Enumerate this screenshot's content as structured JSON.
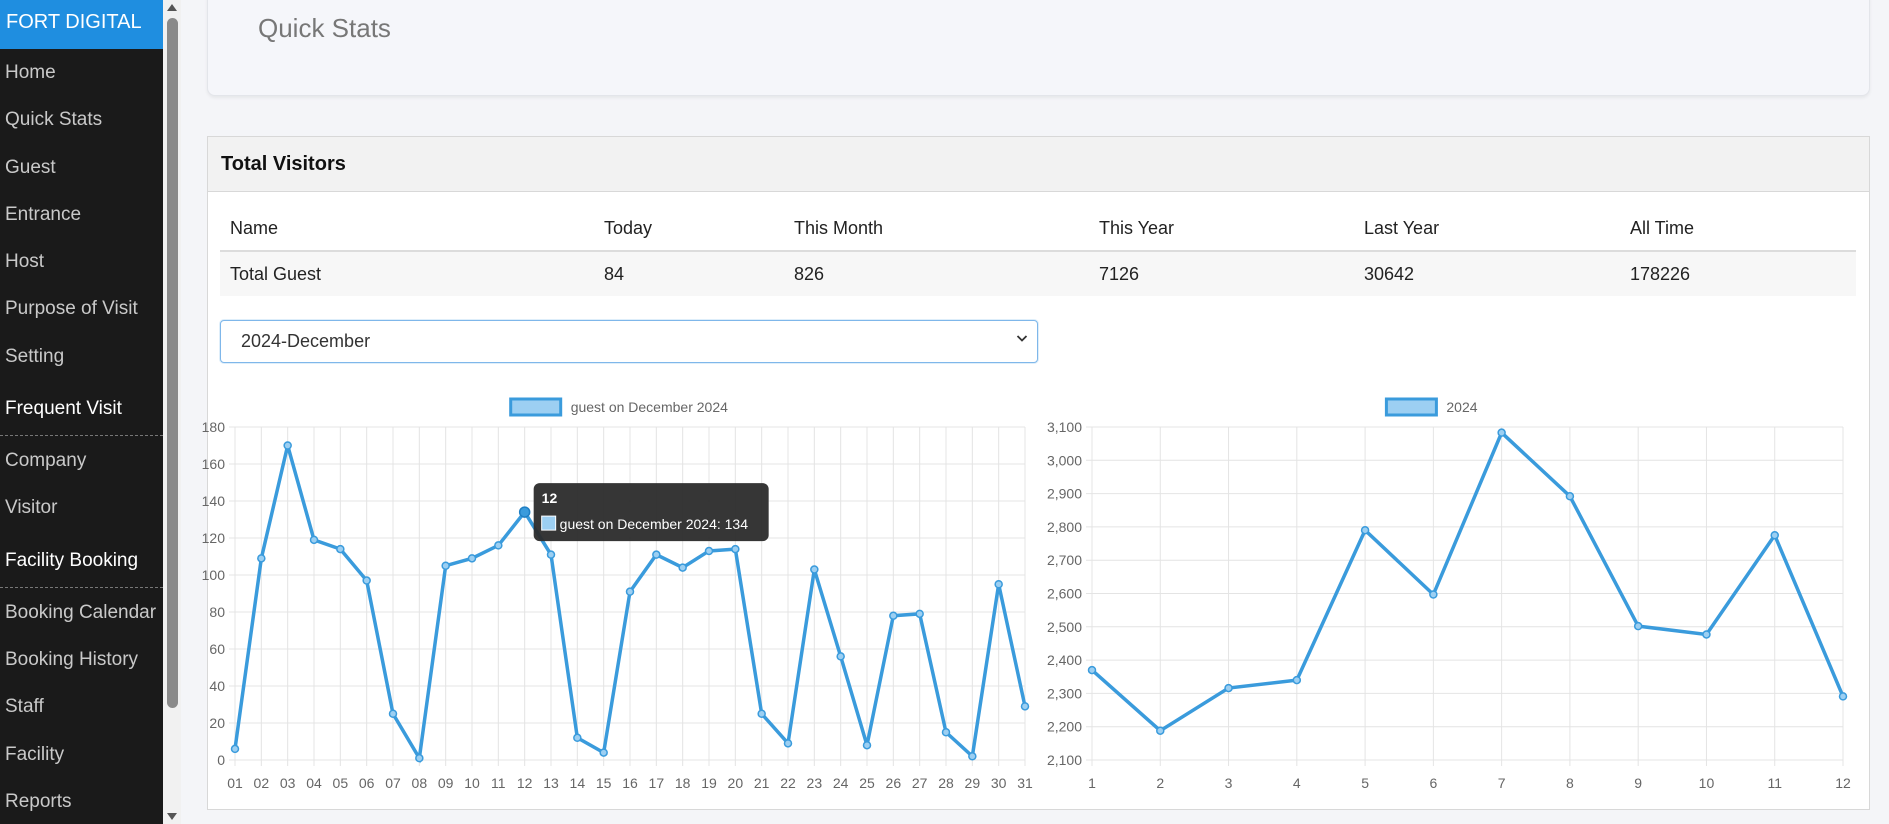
{
  "sidebar": {
    "brand": "FORT DIGITAL",
    "items": [
      {
        "label": "Home",
        "type": "item"
      },
      {
        "label": "Quick Stats",
        "type": "item"
      },
      {
        "label": "Guest",
        "type": "item"
      },
      {
        "label": "Entrance",
        "type": "item"
      },
      {
        "label": "Host",
        "type": "item"
      },
      {
        "label": "Purpose of Visit",
        "type": "item"
      },
      {
        "label": "Setting",
        "type": "item"
      },
      {
        "label": "Frequent Visit",
        "type": "section"
      },
      {
        "label": "Company",
        "type": "item"
      },
      {
        "label": "Visitor",
        "type": "item"
      },
      {
        "label": "Facility Booking",
        "type": "section"
      },
      {
        "label": "Booking Calendar",
        "type": "item"
      },
      {
        "label": "Booking History",
        "type": "item"
      },
      {
        "label": "Staff",
        "type": "item"
      },
      {
        "label": "Facility",
        "type": "item"
      },
      {
        "label": "Reports",
        "type": "item"
      }
    ]
  },
  "quick_stats": {
    "title": "Quick Stats"
  },
  "total_visitors": {
    "title": "Total Visitors",
    "columns": [
      "Name",
      "Today",
      "This Month",
      "This Year",
      "Last Year",
      "All Time"
    ],
    "rows": [
      [
        "Total Guest",
        "84",
        "826",
        "7126",
        "30642",
        "178226"
      ]
    ]
  },
  "month_select": {
    "value": "2024-December"
  },
  "colors": {
    "series": "#3a9bdc",
    "fill": "#9ccff2",
    "grid": "#e4e4e4",
    "tooltip_bg": "#2b2b2b"
  },
  "chart_data": [
    {
      "type": "line",
      "title": "",
      "legend": "guest on December 2024",
      "legend_position": "top-center",
      "grid": true,
      "x": [
        "01",
        "02",
        "03",
        "04",
        "05",
        "06",
        "07",
        "08",
        "09",
        "10",
        "11",
        "12",
        "13",
        "14",
        "15",
        "16",
        "17",
        "18",
        "19",
        "20",
        "21",
        "22",
        "23",
        "24",
        "25",
        "26",
        "27",
        "28",
        "29",
        "30",
        "31"
      ],
      "series": [
        {
          "name": "guest on December 2024",
          "values": [
            6,
            109,
            170,
            119,
            114,
            97,
            25,
            1,
            105,
            109,
            116,
            134,
            111,
            12,
            4,
            91,
            111,
            104,
            113,
            114,
            25,
            9,
            103,
            56,
            8,
            78,
            79,
            15,
            2,
            95,
            29
          ]
        }
      ],
      "ylim": [
        0,
        180
      ],
      "yticks": [
        "0",
        "20",
        "40",
        "60",
        "80",
        "100",
        "120",
        "140",
        "160",
        "180"
      ],
      "tooltip": {
        "title": "12",
        "label": "guest on December 2024: 134",
        "index": 11
      }
    },
    {
      "type": "line",
      "title": "",
      "legend": "2024",
      "legend_position": "top-center",
      "grid": true,
      "x": [
        "1",
        "2",
        "3",
        "4",
        "5",
        "6",
        "7",
        "8",
        "9",
        "10",
        "11",
        "12"
      ],
      "series": [
        {
          "name": "2024",
          "values": [
            2370,
            2188,
            2316,
            2340,
            2790,
            2597,
            3083,
            2892,
            2502,
            2477,
            2775,
            2291
          ]
        }
      ],
      "ylim": [
        2100,
        3100
      ],
      "yticks": [
        "2,100",
        "2,200",
        "2,300",
        "2,400",
        "2,500",
        "2,600",
        "2,700",
        "2,800",
        "2,900",
        "3,000",
        "3,100"
      ]
    }
  ]
}
